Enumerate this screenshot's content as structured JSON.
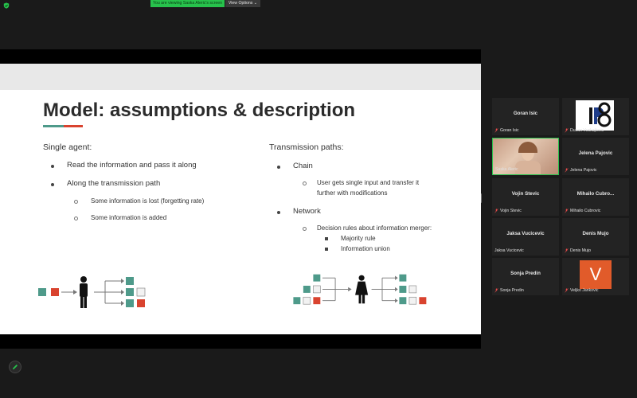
{
  "topbar": {
    "banner_text": "You are viewing Saska Aleric's screen",
    "view_options_label": "View Options"
  },
  "colors": {
    "teal": "#4e9a8a",
    "red": "#d9432f",
    "banner_green": "#27c24c"
  },
  "slide": {
    "title": "Model: assumptions & description",
    "left": {
      "heading": "Single agent:",
      "bullets": [
        "Read the information and pass it along",
        "Along the transmission path"
      ],
      "sub_bullets": [
        "Some information is lost (forgetting rate)",
        "Some information is added"
      ]
    },
    "right": {
      "heading": "Transmission paths:",
      "chain_label": "Chain",
      "chain_sub_1": "User gets single input and transfer it",
      "chain_sub_2": "further with modifications",
      "network_label": "Network",
      "network_sub": "Decision rules about information merger:",
      "rules": [
        "Majority rule",
        "Information union"
      ]
    }
  },
  "participants": [
    {
      "name": "Goran Isic",
      "label": "Goran Isic",
      "type": "name"
    },
    {
      "name": "",
      "label": "Dusan Vuckajlovic",
      "type": "logo",
      "logo_text": "IP8"
    },
    {
      "name": "",
      "label": "Saska Aleric",
      "type": "video"
    },
    {
      "name": "Jelena Pajovic",
      "label": "Jelena Pajovic",
      "type": "name"
    },
    {
      "name": "Vojin Stevic",
      "label": "Vojin Stevic",
      "type": "name"
    },
    {
      "name": "Mihailo Cubro...",
      "label": "Mihailo Cubrovic",
      "type": "name"
    },
    {
      "name": "Jaksa Vucicevic",
      "label": "Jaksa Vucicevic",
      "type": "name"
    },
    {
      "name": "Denis Mujo",
      "label": "Denis Mujo",
      "type": "name"
    },
    {
      "name": "Sonja Predin",
      "label": "Sonja Predin",
      "type": "name"
    },
    {
      "name": "",
      "label": "Veljko Jankovic",
      "type": "avatar",
      "avatar_letter": "V"
    }
  ]
}
